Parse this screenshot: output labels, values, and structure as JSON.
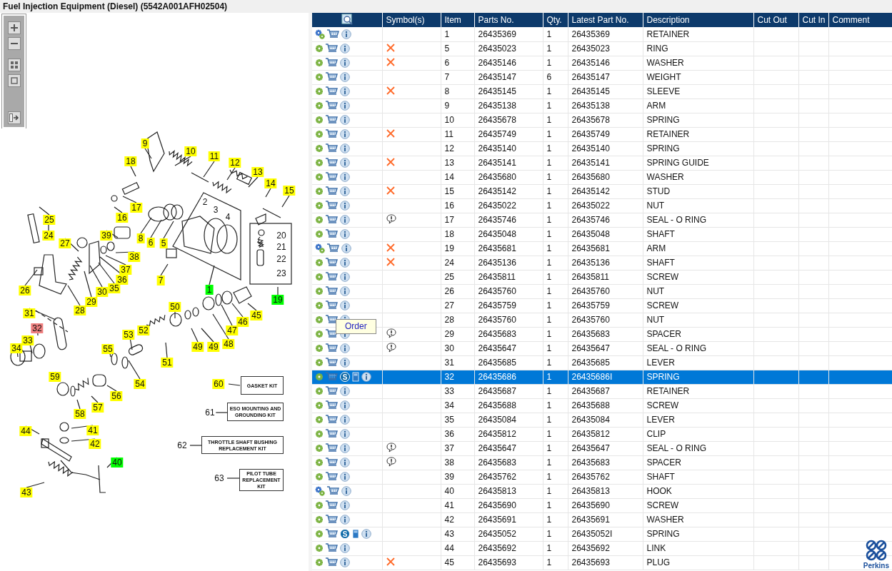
{
  "title": "Fuel Injection Equipment (Diesel) (5542A001AFH02504)",
  "toolbar": [
    {
      "kind": "zoom-in"
    },
    {
      "kind": "zoom-out"
    },
    {
      "kind": "fit"
    },
    {
      "kind": "actual"
    },
    {
      "kind": "panel"
    }
  ],
  "callouts": [
    {
      "text": "9",
      "kind": "yellow"
    },
    {
      "text": "10",
      "kind": "yellow"
    },
    {
      "text": "11",
      "kind": "yellow"
    },
    {
      "text": "12",
      "kind": "yellow"
    },
    {
      "text": "13",
      "kind": "yellow"
    },
    {
      "text": "14",
      "kind": "yellow"
    },
    {
      "text": "15",
      "kind": "yellow"
    },
    {
      "text": "18",
      "kind": "yellow"
    },
    {
      "text": "17",
      "kind": "yellow"
    },
    {
      "text": "16",
      "kind": "yellow"
    },
    {
      "text": "2",
      "kind": "plain"
    },
    {
      "text": "3",
      "kind": "plain"
    },
    {
      "text": "4",
      "kind": "plain"
    },
    {
      "text": "8",
      "kind": "yellow"
    },
    {
      "text": "6",
      "kind": "yellow"
    },
    {
      "text": "5",
      "kind": "yellow"
    },
    {
      "text": "7",
      "kind": "yellow"
    },
    {
      "text": "1",
      "kind": "green"
    },
    {
      "text": "20",
      "kind": "plain"
    },
    {
      "text": "21",
      "kind": "plain"
    },
    {
      "text": "22",
      "kind": "plain"
    },
    {
      "text": "23",
      "kind": "plain"
    },
    {
      "text": "19",
      "kind": "green"
    },
    {
      "text": "25",
      "kind": "yellow"
    },
    {
      "text": "24",
      "kind": "yellow"
    },
    {
      "text": "27",
      "kind": "yellow"
    },
    {
      "text": "39",
      "kind": "yellow"
    },
    {
      "text": "38",
      "kind": "yellow"
    },
    {
      "text": "37",
      "kind": "yellow"
    },
    {
      "text": "36",
      "kind": "yellow"
    },
    {
      "text": "35",
      "kind": "yellow"
    },
    {
      "text": "30",
      "kind": "yellow"
    },
    {
      "text": "29",
      "kind": "yellow"
    },
    {
      "text": "28",
      "kind": "yellow"
    },
    {
      "text": "26",
      "kind": "yellow"
    },
    {
      "text": "31",
      "kind": "yellow"
    },
    {
      "text": "32",
      "kind": "red"
    },
    {
      "text": "33",
      "kind": "yellow"
    },
    {
      "text": "34",
      "kind": "yellow"
    },
    {
      "text": "50",
      "kind": "yellow"
    },
    {
      "text": "45",
      "kind": "yellow"
    },
    {
      "text": "46",
      "kind": "yellow"
    },
    {
      "text": "47",
      "kind": "yellow"
    },
    {
      "text": "48",
      "kind": "yellow"
    },
    {
      "text": "49",
      "kind": "yellow"
    },
    {
      "text": "49",
      "kind": "yellow"
    },
    {
      "text": "53",
      "kind": "yellow"
    },
    {
      "text": "52",
      "kind": "yellow"
    },
    {
      "text": "51",
      "kind": "yellow"
    },
    {
      "text": "55",
      "kind": "yellow"
    },
    {
      "text": "54",
      "kind": "yellow"
    },
    {
      "text": "59",
      "kind": "yellow"
    },
    {
      "text": "56",
      "kind": "yellow"
    },
    {
      "text": "57",
      "kind": "yellow"
    },
    {
      "text": "58",
      "kind": "yellow"
    },
    {
      "text": "60",
      "kind": "yellow"
    },
    {
      "text": "61",
      "kind": "plain"
    },
    {
      "text": "62",
      "kind": "plain"
    },
    {
      "text": "63",
      "kind": "plain"
    },
    {
      "text": "44",
      "kind": "yellow"
    },
    {
      "text": "41",
      "kind": "yellow"
    },
    {
      "text": "42",
      "kind": "yellow"
    },
    {
      "text": "40",
      "kind": "green"
    },
    {
      "text": "43",
      "kind": "yellow"
    }
  ],
  "kits": [
    "GASKET KIT",
    "ESO MOUNTING AND GROUNDING KIT",
    "THROTTLE SHAFT BUSHING REPLACEMENT KIT",
    "PILOT TUBE REPLACEMENT KIT"
  ],
  "table": {
    "columns": [
      "Symbol(s)",
      "Item",
      "Parts No.",
      "Qty.",
      "Latest Part No.",
      "Description",
      "Cut Out",
      "Cut In",
      "Comment"
    ],
    "rows": [
      {
        "multi_gear": true,
        "kind": "none",
        "item": "1",
        "part": "26435369",
        "qty": "1",
        "latest": "26435369",
        "desc": "RETAINER",
        "selected": false
      },
      {
        "multi_gear": false,
        "kind": "cross",
        "item": "5",
        "part": "26435023",
        "qty": "1",
        "latest": "26435023",
        "desc": "RING",
        "selected": false
      },
      {
        "multi_gear": false,
        "kind": "cross",
        "item": "6",
        "part": "26435146",
        "qty": "1",
        "latest": "26435146",
        "desc": "WASHER",
        "selected": false
      },
      {
        "multi_gear": false,
        "kind": "none",
        "item": "7",
        "part": "26435147",
        "qty": "6",
        "latest": "26435147",
        "desc": "WEIGHT",
        "selected": false
      },
      {
        "multi_gear": false,
        "kind": "cross",
        "item": "8",
        "part": "26435145",
        "qty": "1",
        "latest": "26435145",
        "desc": "SLEEVE",
        "selected": false
      },
      {
        "multi_gear": false,
        "kind": "none",
        "item": "9",
        "part": "26435138",
        "qty": "1",
        "latest": "26435138",
        "desc": "ARM",
        "selected": false
      },
      {
        "multi_gear": false,
        "kind": "none",
        "item": "10",
        "part": "26435678",
        "qty": "1",
        "latest": "26435678",
        "desc": "SPRING",
        "selected": false
      },
      {
        "multi_gear": false,
        "kind": "cross",
        "item": "11",
        "part": "26435749",
        "qty": "1",
        "latest": "26435749",
        "desc": "RETAINER",
        "selected": false
      },
      {
        "multi_gear": false,
        "kind": "none",
        "item": "12",
        "part": "26435140",
        "qty": "1",
        "latest": "26435140",
        "desc": "SPRING",
        "selected": false
      },
      {
        "multi_gear": false,
        "kind": "cross",
        "item": "13",
        "part": "26435141",
        "qty": "1",
        "latest": "26435141",
        "desc": "SPRING GUIDE",
        "selected": false
      },
      {
        "multi_gear": false,
        "kind": "none",
        "item": "14",
        "part": "26435680",
        "qty": "1",
        "latest": "26435680",
        "desc": "WASHER",
        "selected": false
      },
      {
        "multi_gear": false,
        "kind": "cross",
        "item": "15",
        "part": "26435142",
        "qty": "1",
        "latest": "26435142",
        "desc": "STUD",
        "selected": false
      },
      {
        "multi_gear": false,
        "kind": "none",
        "item": "16",
        "part": "26435022",
        "qty": "1",
        "latest": "26435022",
        "desc": "NUT",
        "selected": false
      },
      {
        "multi_gear": false,
        "kind": "note",
        "item": "17",
        "part": "26435746",
        "qty": "1",
        "latest": "26435746",
        "desc": "SEAL - O RING",
        "selected": false
      },
      {
        "multi_gear": false,
        "kind": "none",
        "item": "18",
        "part": "26435048",
        "qty": "1",
        "latest": "26435048",
        "desc": "SHAFT",
        "selected": false
      },
      {
        "multi_gear": true,
        "kind": "cross",
        "item": "19",
        "part": "26435681",
        "qty": "1",
        "latest": "26435681",
        "desc": "ARM",
        "selected": false
      },
      {
        "multi_gear": false,
        "kind": "cross",
        "item": "24",
        "part": "26435136",
        "qty": "1",
        "latest": "26435136",
        "desc": "SHAFT",
        "selected": false
      },
      {
        "multi_gear": false,
        "kind": "none",
        "item": "25",
        "part": "26435811",
        "qty": "1",
        "latest": "26435811",
        "desc": "SCREW",
        "selected": false
      },
      {
        "multi_gear": false,
        "kind": "none",
        "item": "26",
        "part": "26435760",
        "qty": "1",
        "latest": "26435760",
        "desc": "NUT",
        "selected": false
      },
      {
        "multi_gear": false,
        "kind": "none",
        "item": "27",
        "part": "26435759",
        "qty": "1",
        "latest": "26435759",
        "desc": "SCREW",
        "selected": false
      },
      {
        "multi_gear": false,
        "kind": "none",
        "item": "28",
        "part": "26435760",
        "qty": "1",
        "latest": "26435760",
        "desc": "NUT",
        "selected": false,
        "tooltip": "Order"
      },
      {
        "multi_gear": false,
        "kind": "note",
        "item": "29",
        "part": "26435683",
        "qty": "1",
        "latest": "26435683",
        "desc": "SPACER",
        "selected": false
      },
      {
        "multi_gear": false,
        "kind": "note",
        "item": "30",
        "part": "26435647",
        "qty": "1",
        "latest": "26435647",
        "desc": "SEAL - O RING",
        "selected": false
      },
      {
        "multi_gear": false,
        "kind": "none",
        "item": "31",
        "part": "26435685",
        "qty": "1",
        "latest": "26435685",
        "desc": "LEVER",
        "selected": false
      },
      {
        "multi_gear": false,
        "kind": "none",
        "item": "32",
        "part": "26435686",
        "qty": "1",
        "latest": "26435686I",
        "desc": "SPRING",
        "selected": true,
        "badge": "S"
      },
      {
        "multi_gear": false,
        "kind": "none",
        "item": "33",
        "part": "26435687",
        "qty": "1",
        "latest": "26435687",
        "desc": "RETAINER",
        "selected": false
      },
      {
        "multi_gear": false,
        "kind": "none",
        "item": "34",
        "part": "26435688",
        "qty": "1",
        "latest": "26435688",
        "desc": "SCREW",
        "selected": false
      },
      {
        "multi_gear": false,
        "kind": "none",
        "item": "35",
        "part": "26435084",
        "qty": "1",
        "latest": "26435084",
        "desc": "LEVER",
        "selected": false
      },
      {
        "multi_gear": false,
        "kind": "none",
        "item": "36",
        "part": "26435812",
        "qty": "1",
        "latest": "26435812",
        "desc": "CLIP",
        "selected": false
      },
      {
        "multi_gear": false,
        "kind": "note",
        "item": "37",
        "part": "26435647",
        "qty": "1",
        "latest": "26435647",
        "desc": "SEAL - O RING",
        "selected": false
      },
      {
        "multi_gear": false,
        "kind": "note",
        "item": "38",
        "part": "26435683",
        "qty": "1",
        "latest": "26435683",
        "desc": "SPACER",
        "selected": false
      },
      {
        "multi_gear": false,
        "kind": "none",
        "item": "39",
        "part": "26435762",
        "qty": "1",
        "latest": "26435762",
        "desc": "SHAFT",
        "selected": false
      },
      {
        "multi_gear": true,
        "kind": "none",
        "item": "40",
        "part": "26435813",
        "qty": "1",
        "latest": "26435813",
        "desc": "HOOK",
        "selected": false
      },
      {
        "multi_gear": false,
        "kind": "none",
        "item": "41",
        "part": "26435690",
        "qty": "1",
        "latest": "26435690",
        "desc": "SCREW",
        "selected": false
      },
      {
        "multi_gear": false,
        "kind": "none",
        "item": "42",
        "part": "26435691",
        "qty": "1",
        "latest": "26435691",
        "desc": "WASHER",
        "selected": false
      },
      {
        "multi_gear": false,
        "kind": "none",
        "item": "43",
        "part": "26435052",
        "qty": "1",
        "latest": "26435052I",
        "desc": "SPRING",
        "selected": false,
        "badge": "S"
      },
      {
        "multi_gear": false,
        "kind": "none",
        "item": "44",
        "part": "26435692",
        "qty": "1",
        "latest": "26435692",
        "desc": "LINK",
        "selected": false
      },
      {
        "multi_gear": false,
        "kind": "cross",
        "item": "45",
        "part": "26435693",
        "qty": "1",
        "latest": "26435693",
        "desc": "PLUG",
        "selected": false
      }
    ]
  },
  "logo": {
    "text": "Perkins"
  }
}
